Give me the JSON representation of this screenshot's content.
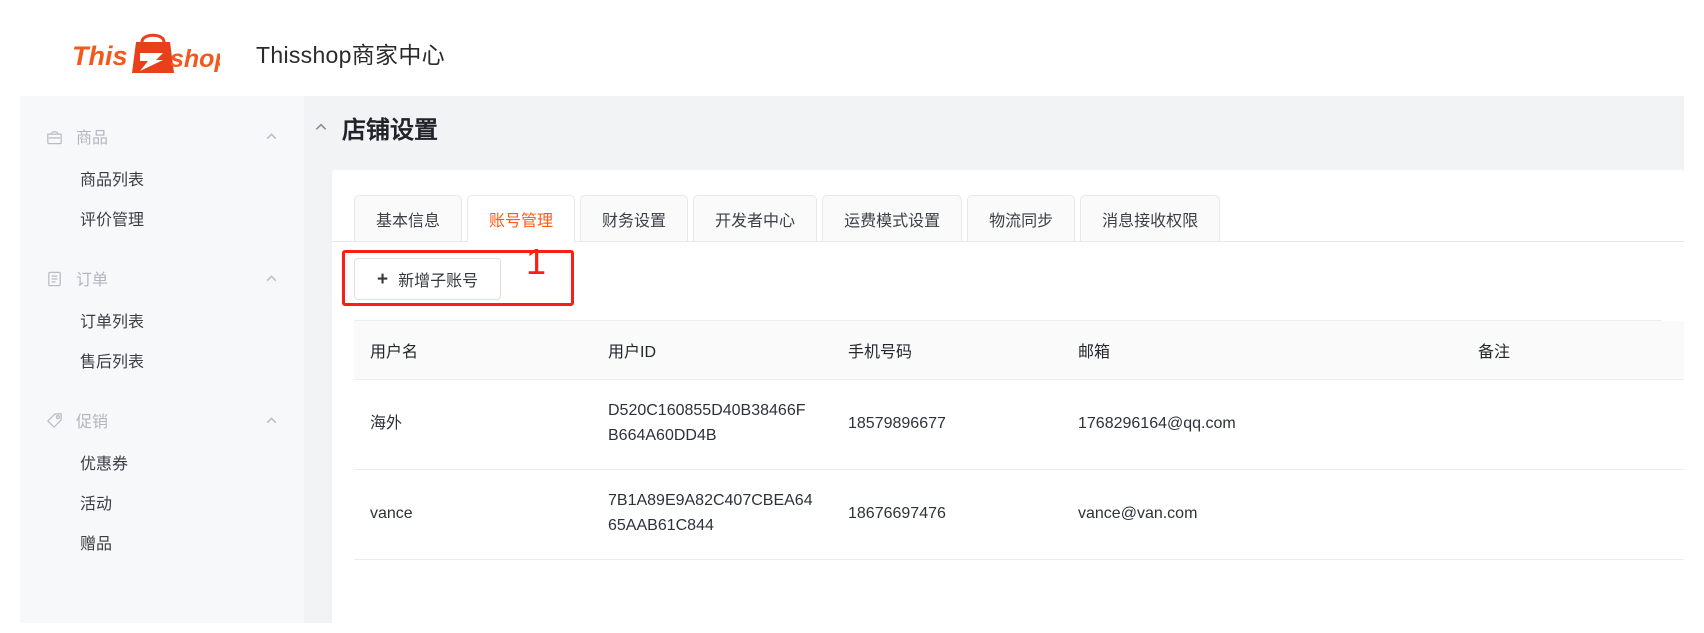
{
  "header": {
    "logo_text_this": "This",
    "logo_text_shop": "shop",
    "logo_icon": "shopping-bag-icon",
    "title": "Thisshop商家中心"
  },
  "sidebar": {
    "groups": [
      {
        "label": "商品",
        "icon": "bag-icon",
        "chevron": "chevron-up-icon",
        "items": [
          {
            "label": "商品列表"
          },
          {
            "label": "评价管理"
          }
        ]
      },
      {
        "label": "订单",
        "icon": "clipboard-icon",
        "chevron": "chevron-up-icon",
        "items": [
          {
            "label": "订单列表"
          },
          {
            "label": "售后列表"
          }
        ]
      },
      {
        "label": "促销",
        "icon": "tag-icon",
        "chevron": "chevron-up-icon",
        "items": [
          {
            "label": "优惠券"
          },
          {
            "label": "活动"
          },
          {
            "label": "赠品"
          }
        ]
      }
    ]
  },
  "main": {
    "page_title": "店铺设置",
    "page_chevron": "chevron-up-icon",
    "tabs": [
      {
        "label": "基本信息",
        "active": false
      },
      {
        "label": "账号管理",
        "active": true
      },
      {
        "label": "财务设置",
        "active": false
      },
      {
        "label": "开发者中心",
        "active": false
      },
      {
        "label": "运费模式设置",
        "active": false
      },
      {
        "label": "物流同步",
        "active": false
      },
      {
        "label": "消息接收权限",
        "active": false
      }
    ],
    "toolbar": {
      "add_account_label": "新增子账号",
      "add_account_plus": "+"
    },
    "annotation": {
      "number": "1",
      "color": "#fa1e14"
    },
    "table": {
      "columns": [
        "用户名",
        "用户ID",
        "手机号码",
        "邮箱",
        "备注"
      ],
      "rows": [
        {
          "username": "海外",
          "user_id": "D520C160855D40B38466FB664A60DD4B",
          "phone": "18579896677",
          "email": "1768296164@qq.com",
          "note": ""
        },
        {
          "username": "vance",
          "user_id": "7B1A89E9A82C407CBEA6465AAB61C844",
          "phone": "18676697476",
          "email": "vance@van.com",
          "note": ""
        }
      ]
    }
  },
  "colors": {
    "brand_orange": "#f4581c",
    "active_tab": "#ff5a14",
    "annotation_red": "#fa1e14"
  }
}
